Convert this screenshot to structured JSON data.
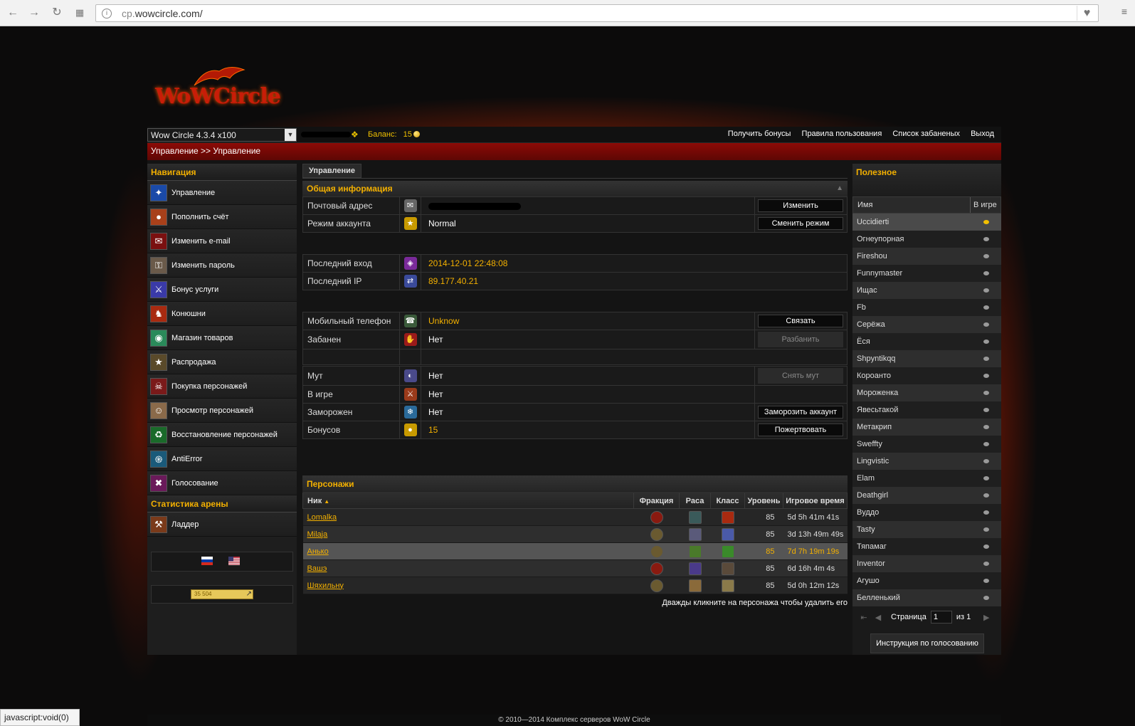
{
  "browser": {
    "url_prefix": "cp.",
    "url_host": "wowcircle.com/",
    "status_text": "javascript:void(0)"
  },
  "brand": {
    "logo_text": "WoWCircle",
    "accent_color": "#f3b000",
    "header_color": "#8c0a06"
  },
  "topbar": {
    "server": "Wow Circle 4.3.4 x100",
    "balance_label": "Баланс:",
    "balance_value": "15",
    "links": [
      "Получить бонусы",
      "Правила пользования",
      "Список забаненых",
      "Выход"
    ]
  },
  "breadcrumb": "Управление >> Управление",
  "sidebar": {
    "nav_title": "Навигация",
    "items": [
      {
        "label": "Управление",
        "icon": "manage-icon",
        "color": "#1a4aa8"
      },
      {
        "label": "Пополнить счёт",
        "icon": "coins-icon",
        "color": "#a8401a"
      },
      {
        "label": "Изменить e-mail",
        "icon": "mail-icon",
        "color": "#7a1010"
      },
      {
        "label": "Изменить пароль",
        "icon": "key-icon",
        "color": "#6a5a4a"
      },
      {
        "label": "Бонус услуги",
        "icon": "sword-icon",
        "color": "#3a3aa8"
      },
      {
        "label": "Конюшни",
        "icon": "horse-icon",
        "color": "#a82a10"
      },
      {
        "label": "Магазин товаров",
        "icon": "orb-icon",
        "color": "#2a8a5a"
      },
      {
        "label": "Распродажа",
        "icon": "sale-icon",
        "color": "#5a4a2a"
      },
      {
        "label": "Покупка персонажей",
        "icon": "buy-character-icon",
        "color": "#7a1a1a"
      },
      {
        "label": "Просмотр персонажей",
        "icon": "view-character-icon",
        "color": "#8a6a4a"
      },
      {
        "label": "Восстановление персонажей",
        "icon": "restore-icon",
        "color": "#1a6a2a"
      },
      {
        "label": "AntiError",
        "icon": "swirl-icon",
        "color": "#1a5a7a"
      },
      {
        "label": "Голосование",
        "icon": "vote-icon",
        "color": "#6a1a5a"
      }
    ],
    "arena_title": "Статистика арены",
    "arena_items": [
      {
        "label": "Ладдер",
        "icon": "ladder-icon",
        "color": "#7a3a1a"
      }
    ],
    "counter_value": "35 504"
  },
  "main": {
    "tab": "Управление",
    "info_title": "Общая информация",
    "rows_a": [
      {
        "label": "Почтовый адрес",
        "icon": "mail-icon",
        "icon_color": "#666",
        "value": "",
        "masked": true,
        "action": "Изменить"
      },
      {
        "label": "Режим аккаунта",
        "icon": "star-icon",
        "icon_color": "#c89a00",
        "value": "Normal",
        "action": "Сменить режим"
      }
    ],
    "rows_b": [
      {
        "label": "Последний вход",
        "icon": "login-icon",
        "icon_color": "#7a2a9a",
        "value": "2014-12-01 22:48:08"
      },
      {
        "label": "Последний IP",
        "icon": "ip-icon",
        "icon_color": "#3a4a9a",
        "value": "89.177.40.21"
      }
    ],
    "rows_c": [
      {
        "label": "Мобильный телефон",
        "icon": "phone-icon",
        "icon_color": "#3a5a3a",
        "value": "Unknow",
        "gold": true,
        "action": "Связать"
      },
      {
        "label": "Забанен",
        "icon": "ban-icon",
        "icon_color": "#9a1a1a",
        "value": "Нет",
        "action": "Разбанить",
        "disabled": true
      }
    ],
    "rows_d": [
      {
        "label": "Мут",
        "icon": "mute-icon",
        "icon_color": "#4a4a8a",
        "value": "Нет",
        "action": "Снять мут",
        "disabled": true
      },
      {
        "label": "В игре",
        "icon": "ingame-icon",
        "icon_color": "#9a3a1a",
        "value": "Нет"
      },
      {
        "label": "Заморожен",
        "icon": "freeze-icon",
        "icon_color": "#2a6a9a",
        "value": "Нет",
        "action": "Заморозить аккаунт"
      },
      {
        "label": "Бонусов",
        "icon": "coin-icon",
        "icon_color": "#c89a00",
        "value": "15",
        "gold": true,
        "action": "Пожертвовать"
      }
    ],
    "chars_title": "Персонажи",
    "chars_columns": [
      "Ник",
      "Фракция",
      "Раса",
      "Класс",
      "Уровень",
      "Игровое время"
    ],
    "characters": [
      {
        "name": "Lomalka",
        "faction": "horde",
        "race": "undead",
        "class": "mage",
        "level": "85",
        "time": "5d 5h 41m 41s"
      },
      {
        "name": "Milaja",
        "faction": "alliance",
        "race": "human",
        "class": "paladin",
        "level": "85",
        "time": "3d 13h 49m 49s"
      },
      {
        "name": "Анько",
        "faction": "alliance",
        "race": "goblin",
        "class": "hunter",
        "level": "85",
        "time": "7d 7h 19m 19s"
      },
      {
        "name": "Вашэ",
        "faction": "horde",
        "race": "blood-elf",
        "class": "warrior",
        "level": "85",
        "time": "6d 16h 4m 4s"
      },
      {
        "name": "Шяхильну",
        "faction": "alliance",
        "race": "worgen",
        "class": "rogue",
        "level": "85",
        "time": "5d 0h 12m 12s"
      }
    ],
    "chars_hint": "Дважды кликните на персонажа чтобы удалить его"
  },
  "right": {
    "title": "Полезное",
    "col_name": "Имя",
    "col_ingame": "В игре",
    "players": [
      {
        "name": "Uccidierti",
        "online": true
      },
      {
        "name": "Огнеупорная",
        "online": false
      },
      {
        "name": "Fireshou",
        "online": false
      },
      {
        "name": "Funnymaster",
        "online": false
      },
      {
        "name": "Ищас",
        "online": false
      },
      {
        "name": "Fb",
        "online": false
      },
      {
        "name": "Серёжа",
        "online": false
      },
      {
        "name": "Ёся",
        "online": false
      },
      {
        "name": "Shpyntikqq",
        "online": false
      },
      {
        "name": "Короанто",
        "online": false
      },
      {
        "name": "Мороженка",
        "online": false
      },
      {
        "name": "Явесьтакой",
        "online": false
      },
      {
        "name": "Метакрип",
        "online": false
      },
      {
        "name": "Sweffty",
        "online": false
      },
      {
        "name": "Lingvistic",
        "online": false
      },
      {
        "name": "Elam",
        "online": false
      },
      {
        "name": "Deathgirl",
        "online": false
      },
      {
        "name": "Вуддо",
        "online": false
      },
      {
        "name": "Tasty",
        "online": false
      },
      {
        "name": "Тяпамаг",
        "online": false
      },
      {
        "name": "Inventor",
        "online": false
      },
      {
        "name": "Агушо",
        "online": false
      },
      {
        "name": "Белленький",
        "online": false
      }
    ],
    "page_label": "Страница",
    "page_value": "1",
    "page_of": "из 1",
    "vote_button": "Инструкция по голосованию"
  },
  "footer": "© 2010—2014 Комплекс серверов WoW Circle"
}
